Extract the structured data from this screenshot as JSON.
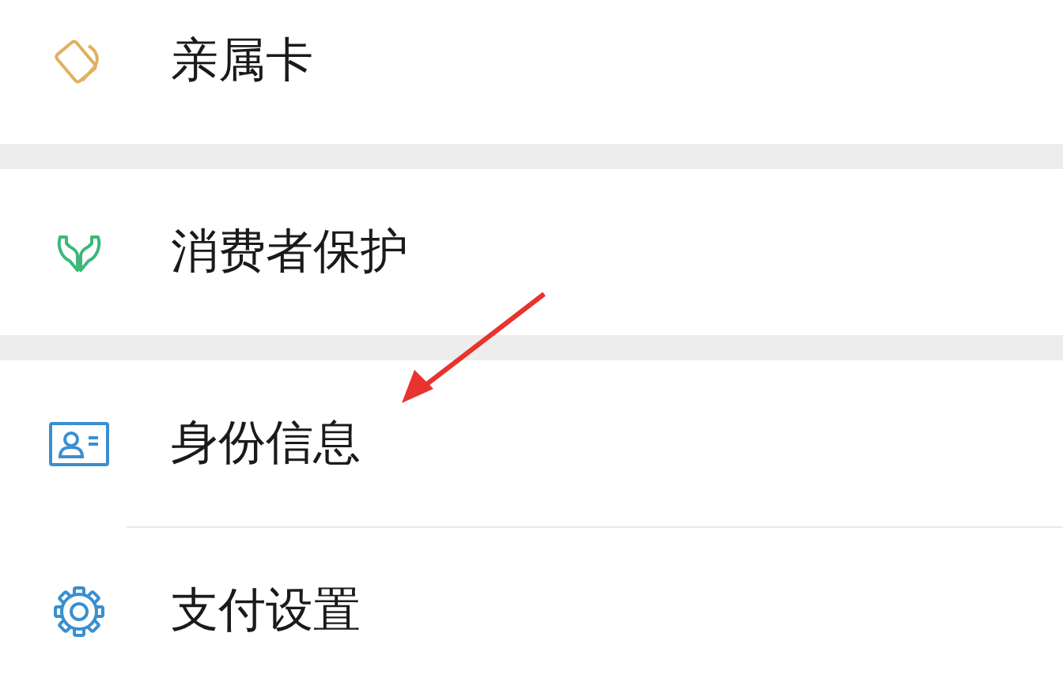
{
  "sections": [
    {
      "items": [
        {
          "label": "亲属卡",
          "kind": "cards",
          "color": "#e0b060"
        }
      ]
    },
    {
      "items": [
        {
          "label": "消费者保护",
          "kind": "hands",
          "color": "#3cb878"
        }
      ]
    },
    {
      "items": [
        {
          "label": "身份信息",
          "kind": "id-card",
          "color": "#3a8fd0"
        },
        {
          "label": "支付设置",
          "kind": "gear",
          "color": "#3a8fd0"
        }
      ]
    }
  ],
  "annotation_arrow": {
    "color": "#e8332e"
  }
}
